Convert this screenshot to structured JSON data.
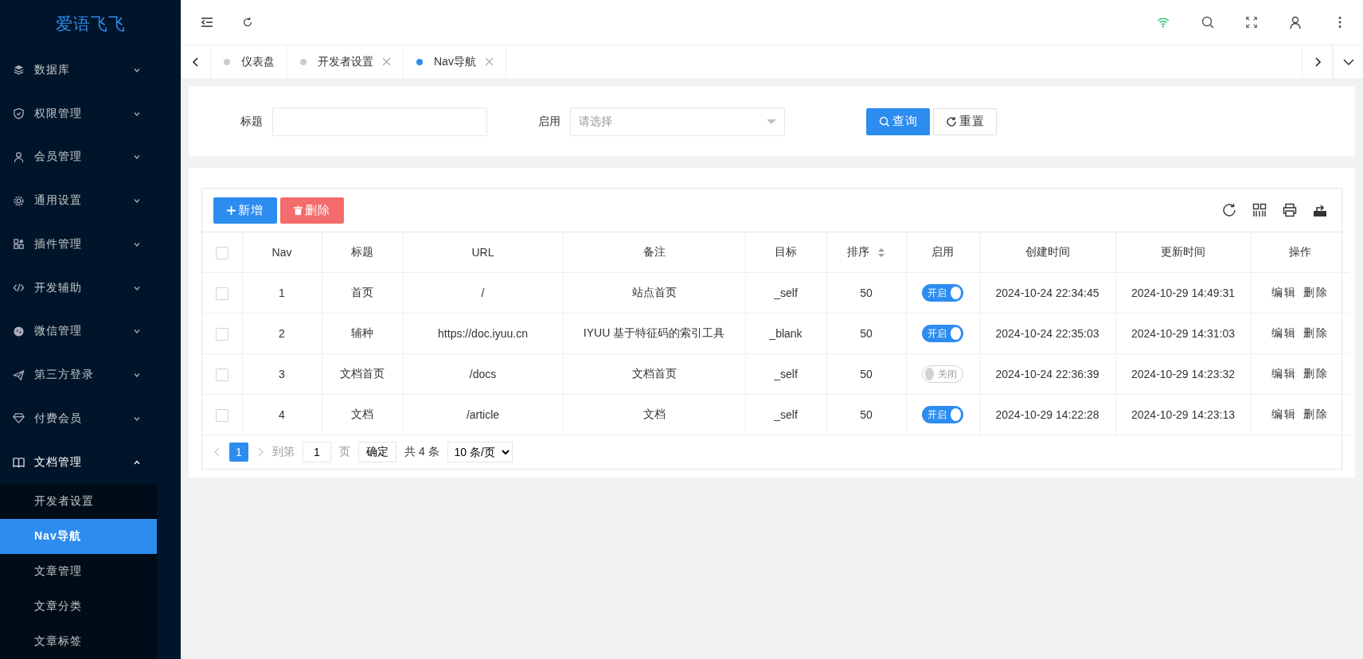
{
  "sidebar": {
    "logo": "爱语飞飞",
    "items": [
      {
        "label": "数据库",
        "expanded": false
      },
      {
        "label": "权限管理",
        "expanded": false
      },
      {
        "label": "会员管理",
        "expanded": false
      },
      {
        "label": "通用设置",
        "expanded": false
      },
      {
        "label": "插件管理",
        "expanded": false
      },
      {
        "label": "开发辅助",
        "expanded": false
      },
      {
        "label": "微信管理",
        "expanded": false
      },
      {
        "label": "第三方登录",
        "expanded": false
      },
      {
        "label": "付费会员",
        "expanded": false
      },
      {
        "label": "文档管理",
        "expanded": true,
        "children": [
          {
            "label": "开发者设置",
            "selected": false
          },
          {
            "label": "Nav导航",
            "selected": true
          },
          {
            "label": "文章管理",
            "selected": false
          },
          {
            "label": "文章分类",
            "selected": false
          },
          {
            "label": "文章标签",
            "selected": false
          }
        ]
      }
    ]
  },
  "tabs": [
    {
      "label": "仪表盘",
      "selected": false,
      "closable": false
    },
    {
      "label": "开发者设置",
      "selected": false,
      "closable": true
    },
    {
      "label": "Nav导航",
      "selected": true,
      "closable": true
    }
  ],
  "search": {
    "fields": [
      {
        "label": "标题",
        "kind": "text"
      },
      {
        "label": "启用",
        "kind": "select",
        "placeholder": "请选择"
      }
    ],
    "buttons": [
      {
        "label": "查询",
        "kind": "primary"
      },
      {
        "label": "重置",
        "kind": "default"
      }
    ]
  },
  "table": {
    "select_all_checked": false,
    "buttons": [
      {
        "label": "新增",
        "kind": "add"
      },
      {
        "label": "删除",
        "kind": "danger"
      }
    ],
    "columns": [
      {
        "label": "Nav",
        "sortable": false
      },
      {
        "label": "标题",
        "sortable": false
      },
      {
        "label": "URL",
        "sortable": false
      },
      {
        "label": "备注",
        "sortable": false
      },
      {
        "label": "目标",
        "sortable": false
      },
      {
        "label": "排序",
        "sortable": true
      },
      {
        "label": "启用",
        "sortable": false
      },
      {
        "label": "创建时间",
        "sortable": false
      },
      {
        "label": "更新时间",
        "sortable": false
      },
      {
        "label": "操作",
        "sortable": false
      }
    ],
    "rows": [
      {
        "checked": false,
        "cells": [
          "1",
          "首页",
          "/",
          "站点首页",
          "_self",
          "50"
        ],
        "enabled": {
          "on": true,
          "label": "开启"
        },
        "created": "2024-10-24 22:34:45",
        "updated": "2024-10-29 14:49:31",
        "actions": [
          "编辑",
          "删除"
        ]
      },
      {
        "checked": false,
        "cells": [
          "2",
          "辅种",
          "https://doc.iyuu.cn",
          "IYUU 基于特征码的索引工具",
          "_blank",
          "50"
        ],
        "enabled": {
          "on": true,
          "label": "开启"
        },
        "created": "2024-10-24 22:35:03",
        "updated": "2024-10-29 14:31:03",
        "actions": [
          "编辑",
          "删除"
        ]
      },
      {
        "checked": false,
        "cells": [
          "3",
          "文档首页",
          "/docs",
          "文档首页",
          "_self",
          "50"
        ],
        "enabled": {
          "on": false,
          "label": "关闭"
        },
        "created": "2024-10-24 22:36:39",
        "updated": "2024-10-29 14:23:32",
        "actions": [
          "编辑",
          "删除"
        ]
      },
      {
        "checked": false,
        "cells": [
          "4",
          "文档",
          "/article",
          "文档",
          "_self",
          "50"
        ],
        "enabled": {
          "on": true,
          "label": "开启"
        },
        "created": "2024-10-29 14:22:28",
        "updated": "2024-10-29 14:23:13",
        "actions": [
          "编辑",
          "删除"
        ]
      }
    ],
    "pagination": {
      "pages": [
        {
          "label": "1",
          "selected": true
        }
      ],
      "goto_label": "到第",
      "goto_value": "1",
      "page_unit": "页",
      "confirm": "确定",
      "total": "共 4 条",
      "page_size": "10 条/页"
    }
  }
}
